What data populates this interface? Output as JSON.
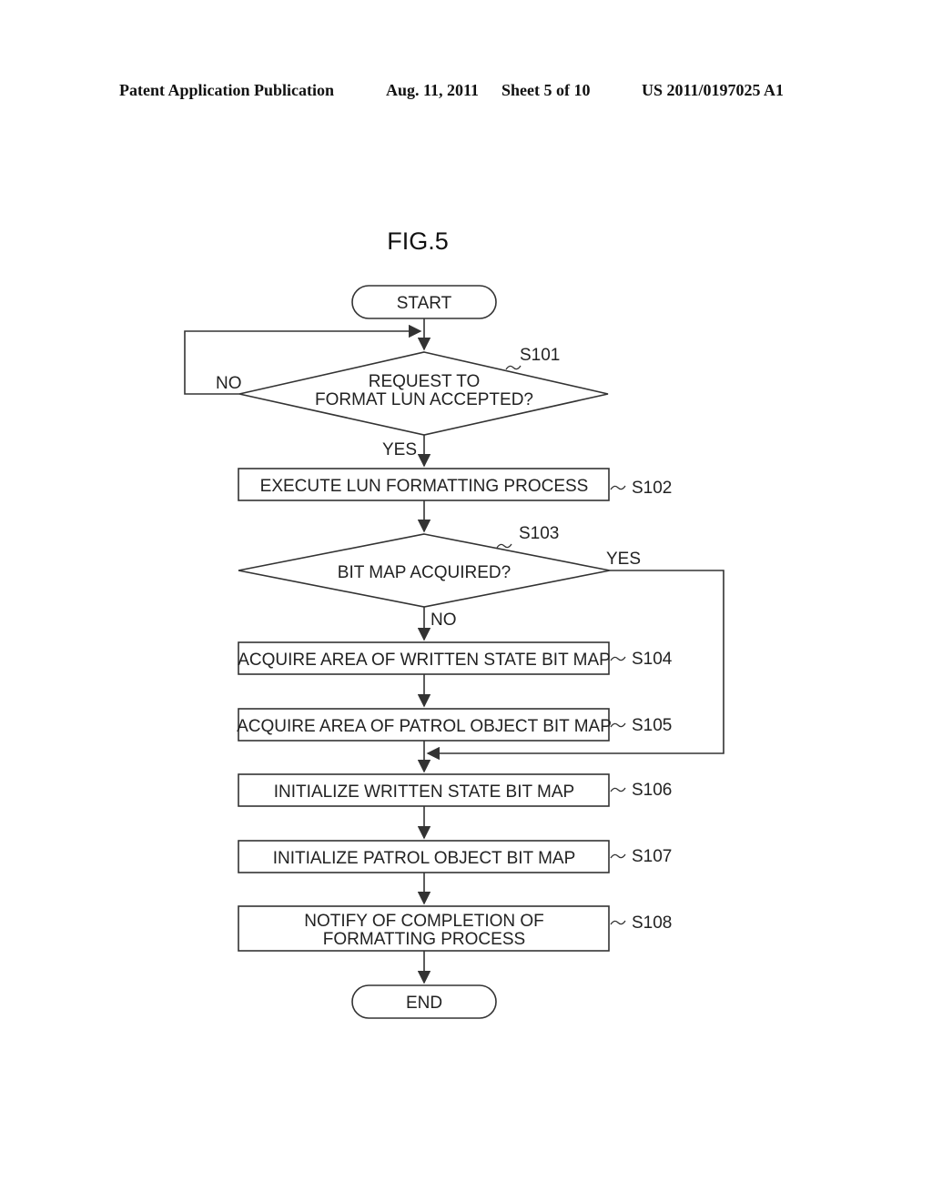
{
  "header": {
    "publication": "Patent Application Publication",
    "date": "Aug. 11, 2011",
    "sheet": "Sheet 5 of 10",
    "number": "US 2011/0197025 A1"
  },
  "figure": {
    "title": "FIG.5",
    "start": "START",
    "end": "END",
    "steps": {
      "s101": {
        "id": "S101",
        "type": "decision",
        "lines": [
          "REQUEST TO",
          "FORMAT LUN ACCEPTED?"
        ],
        "yes_label": "YES",
        "no_label": "NO"
      },
      "s102": {
        "id": "S102",
        "type": "process",
        "lines": [
          "EXECUTE LUN FORMATTING PROCESS"
        ]
      },
      "s103": {
        "id": "S103",
        "type": "decision",
        "lines": [
          "BIT MAP ACQUIRED?"
        ],
        "yes_label": "YES",
        "no_label": "NO"
      },
      "s104": {
        "id": "S104",
        "type": "process",
        "lines": [
          "ACQUIRE AREA OF WRITTEN STATE BIT MAP"
        ]
      },
      "s105": {
        "id": "S105",
        "type": "process",
        "lines": [
          "ACQUIRE AREA OF PATROL OBJECT BIT MAP"
        ]
      },
      "s106": {
        "id": "S106",
        "type": "process",
        "lines": [
          "INITIALIZE WRITTEN STATE BIT MAP"
        ]
      },
      "s107": {
        "id": "S107",
        "type": "process",
        "lines": [
          "INITIALIZE PATROL OBJECT BIT MAP"
        ]
      },
      "s108": {
        "id": "S108",
        "type": "process",
        "lines": [
          "NOTIFY OF COMPLETION OF",
          "FORMATTING PROCESS"
        ]
      }
    }
  }
}
